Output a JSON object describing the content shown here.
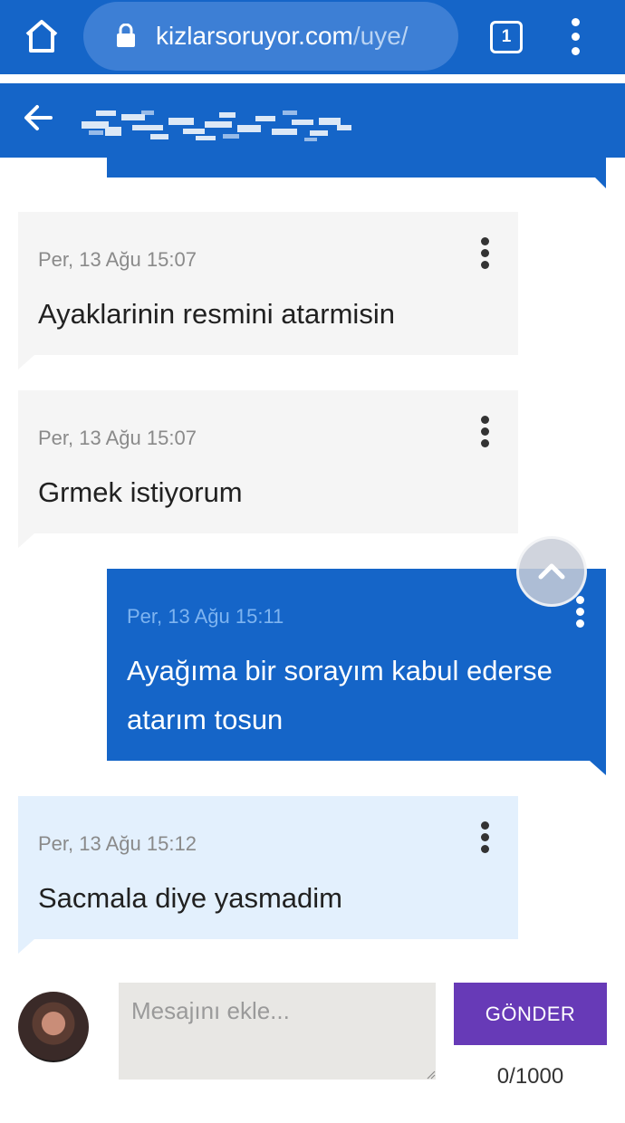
{
  "browser": {
    "url_domain": "kizlarsoruyor.com",
    "url_path": "/uye/",
    "tab_count": "1",
    "icons": [
      "home-icon",
      "lock-icon",
      "tabs-icon",
      "more-vert-icon"
    ]
  },
  "header": {
    "icons": [
      "back-arrow-icon"
    ]
  },
  "messages": [
    {
      "time": "Per, 13 Ağu 15:07",
      "text": "Ayaklarinin resmini atarmisin",
      "type": "received"
    },
    {
      "time": "Per, 13 Ağu 15:07",
      "text": "Grmek istiyorum",
      "type": "received"
    },
    {
      "time": "Per, 13 Ağu 15:11",
      "text": "Ayağıma bir sorayım kabul ederse atarım tosun",
      "type": "sent"
    },
    {
      "time": "Per, 13 Ağu 15:12",
      "text": "Sacmala diye yasmadim",
      "type": "received-highlighted"
    }
  ],
  "composer": {
    "placeholder": "Mesajını ekle...",
    "send_label": "GÖNDER",
    "char_count": "0/1000"
  },
  "colors": {
    "primary": "#1565c8",
    "received_bubble": "#f5f5f5",
    "highlighted_bubble": "#e3f0fd",
    "send_button": "#673ab7"
  }
}
